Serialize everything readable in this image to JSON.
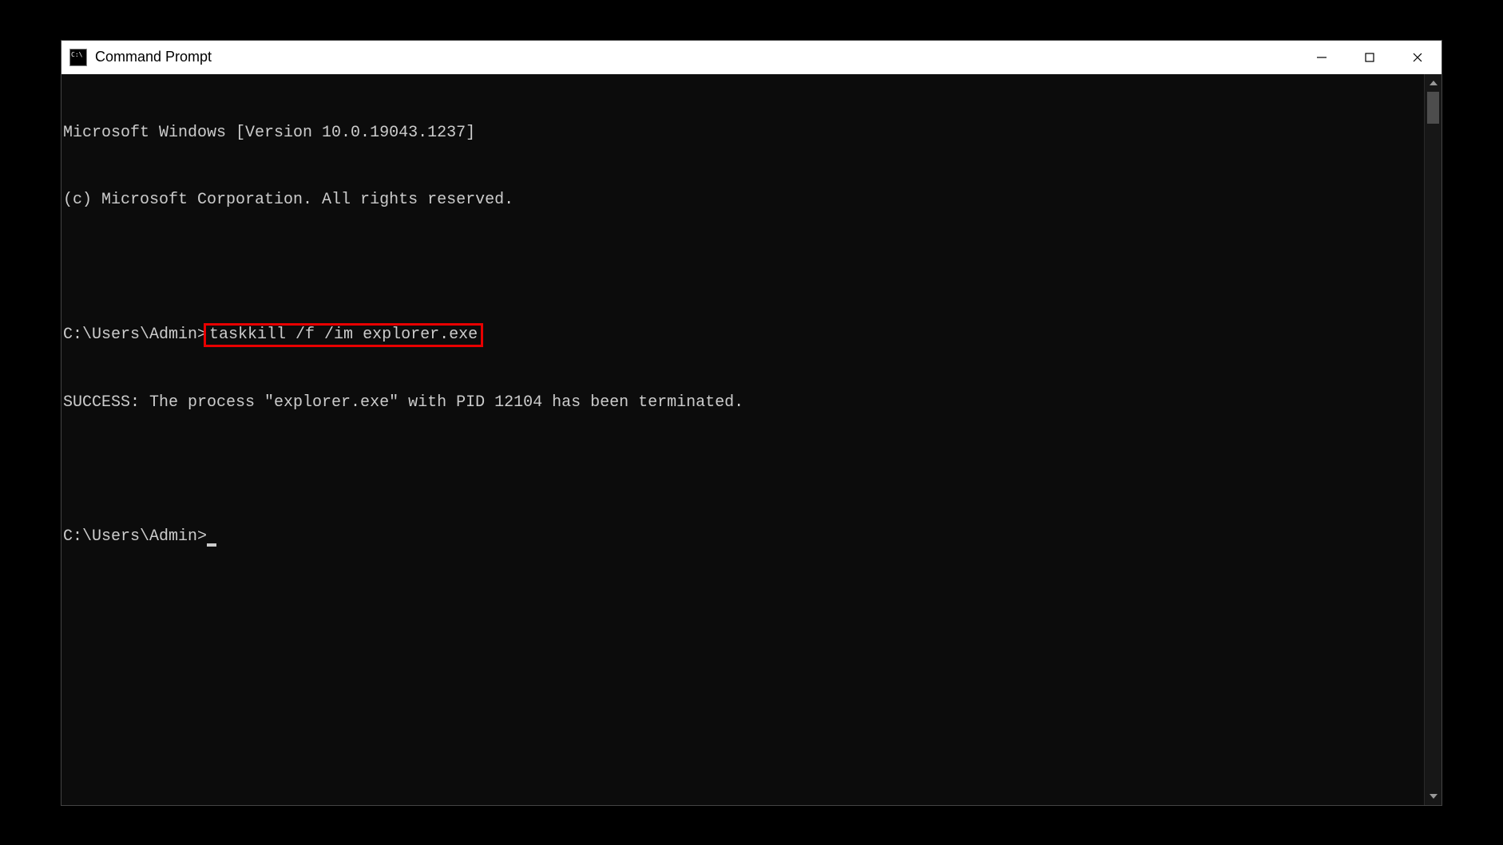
{
  "window": {
    "title": "Command Prompt"
  },
  "terminal": {
    "banner_line1": "Microsoft Windows [Version 10.0.19043.1237]",
    "banner_line2": "(c) Microsoft Corporation. All rights reserved.",
    "prompt1_path": "C:\\Users\\Admin>",
    "prompt1_command": "taskkill /f /im explorer.exe",
    "result_line": "SUCCESS: The process \"explorer.exe\" with PID 12104 has been terminated.",
    "prompt2_path": "C:\\Users\\Admin>"
  }
}
